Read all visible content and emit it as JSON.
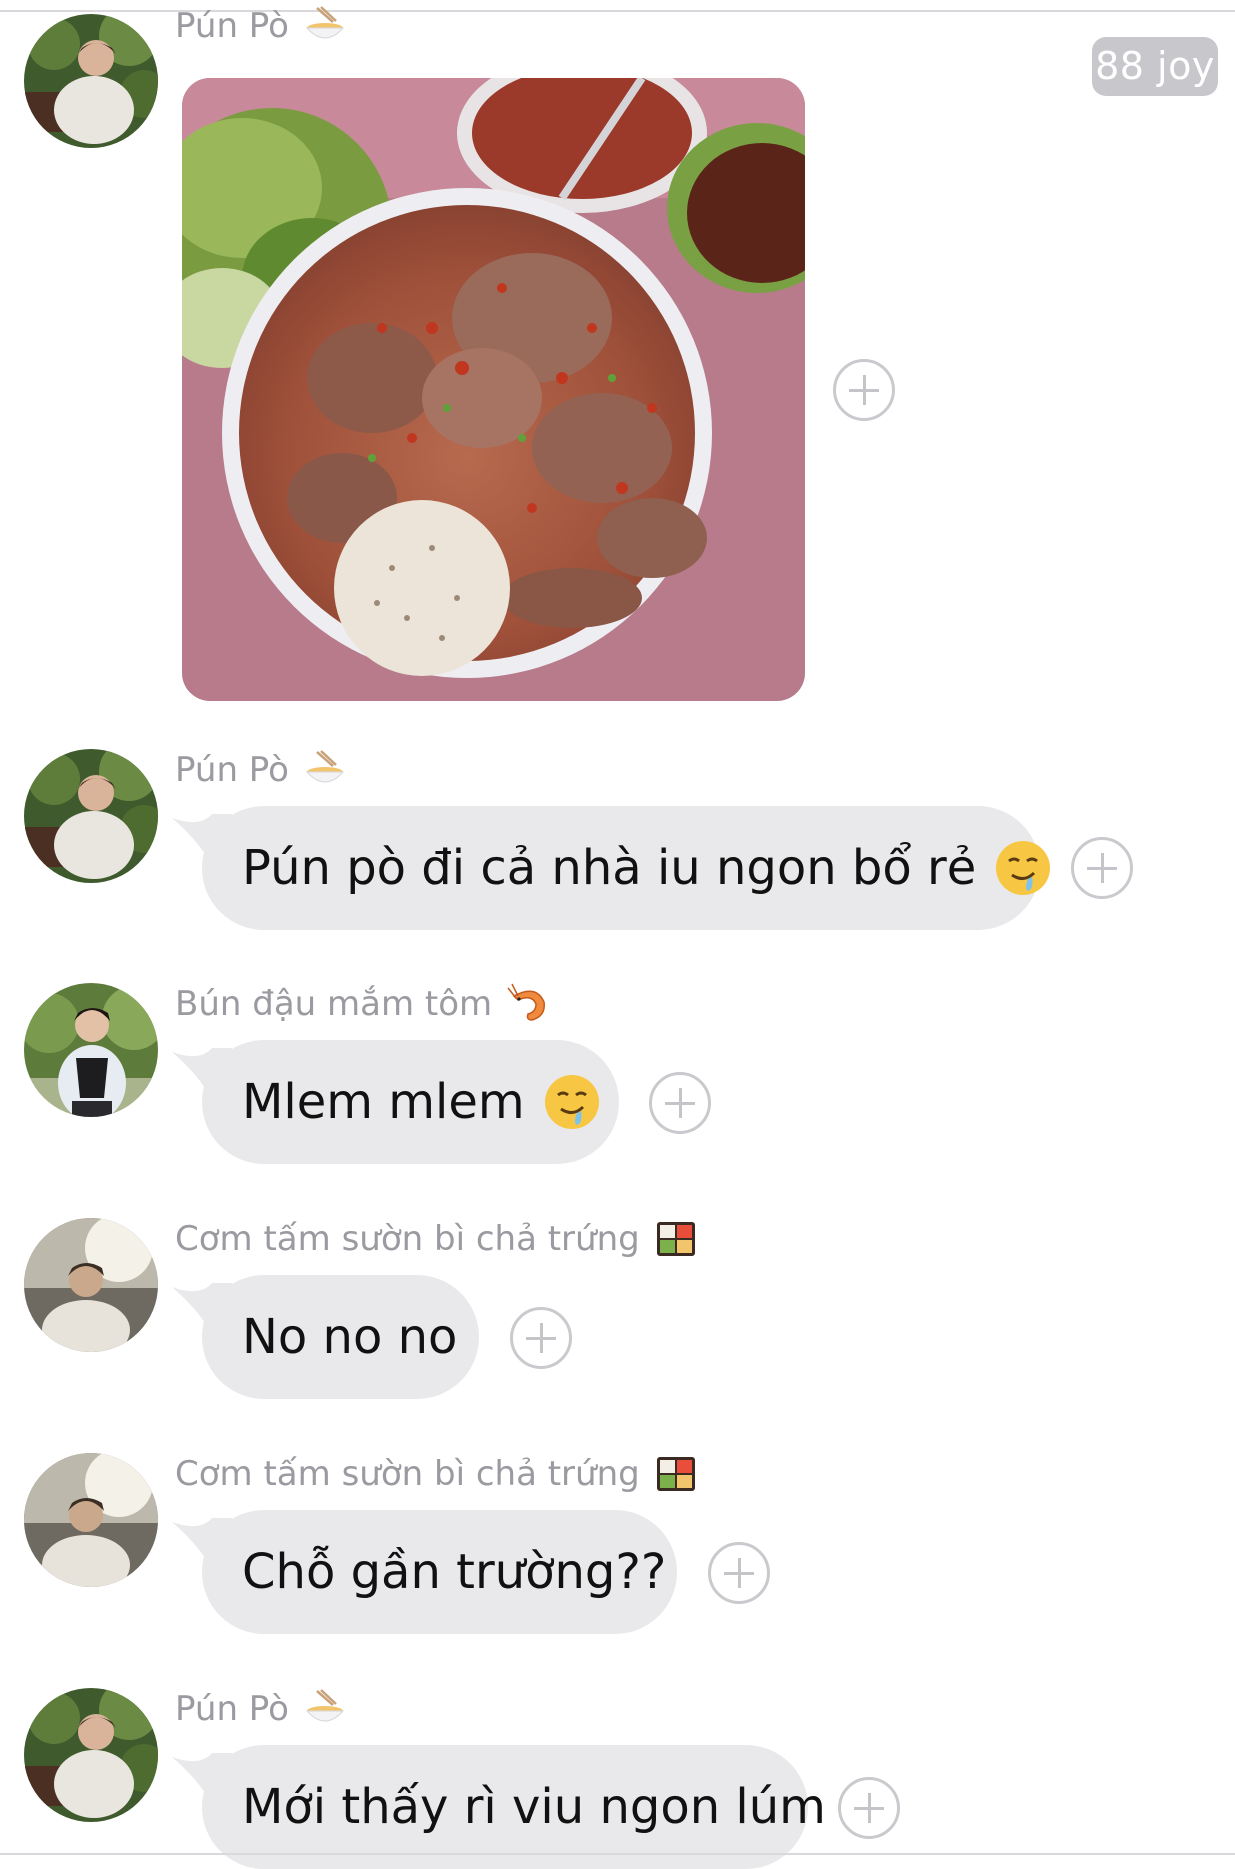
{
  "badge": {
    "label": "88 joy"
  },
  "messages": [
    {
      "sender": "Pún Pò",
      "sender_emoji": "noodle-bowl",
      "type": "image",
      "image_subject": "bowl of beef noodle soup"
    },
    {
      "sender": "Pún Pò",
      "sender_emoji": "noodle-bowl",
      "type": "text",
      "text": "Pún pò đi cả nhà iu ngon bổ rẻ",
      "inline_emoji": "drooling-face"
    },
    {
      "sender": "Bún đậu mắm tôm",
      "sender_emoji": "shrimp",
      "type": "text",
      "text": "Mlem mlem",
      "inline_emoji": "drooling-face"
    },
    {
      "sender": "Cơm tấm sườn bì chả trứng",
      "sender_emoji": "bento-box",
      "type": "text",
      "text": "No no no"
    },
    {
      "sender": "Cơm tấm sườn bì chả trứng",
      "sender_emoji": "bento-box",
      "type": "text",
      "text": "Chỗ gần trường??"
    },
    {
      "sender": "Pún Pò",
      "sender_emoji": "noodle-bowl",
      "type": "text",
      "text": "Mới thấy rì viu ngon lúm"
    }
  ],
  "colors": {
    "bubble": "#e9e9eb",
    "sender_text": "#9a9aa0",
    "badge_bg": "#c8c8cc",
    "react_outline": "#c9c9ce"
  }
}
